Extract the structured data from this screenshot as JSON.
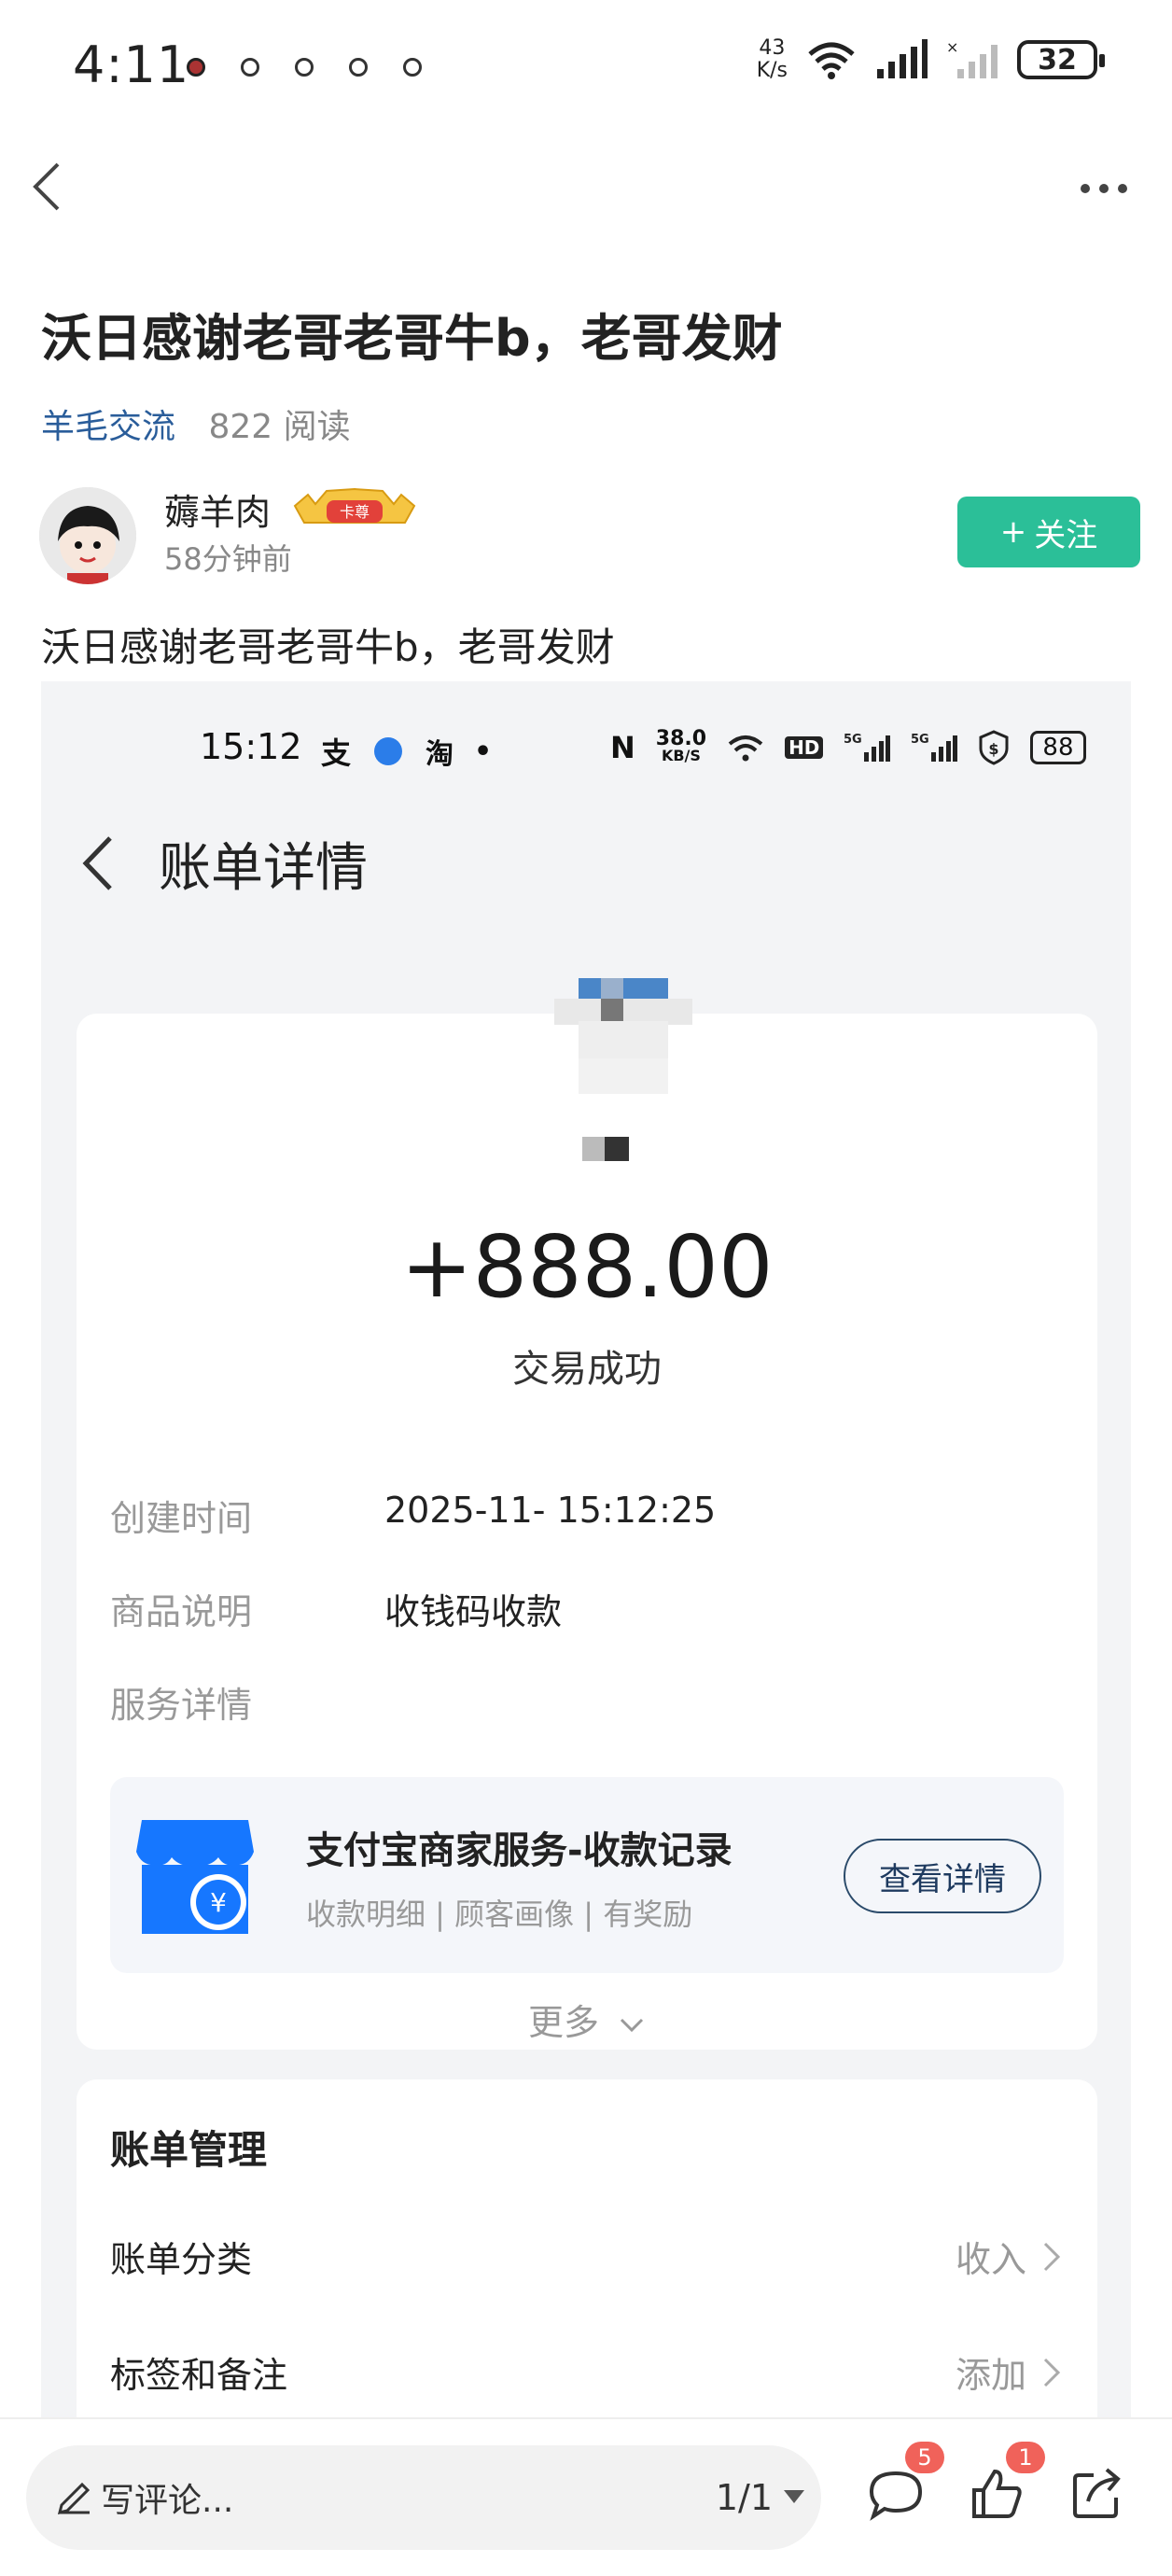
{
  "status_bar": {
    "time": "4:11",
    "net_speed_value": "43",
    "net_speed_unit": "K/s",
    "battery": "32"
  },
  "post": {
    "title": "沃日感谢老哥老哥牛b，老哥发财",
    "category": "羊毛交流",
    "reads": "822 阅读",
    "body": "沃日感谢老哥老哥牛b，老哥发财"
  },
  "author": {
    "name": "薅羊肉",
    "badge": "卡尊",
    "time": "58分钟前",
    "follow_label": "关注"
  },
  "screenshot": {
    "status_time": "15:12",
    "net_speed_value": "38.0",
    "net_speed_unit": "KB/S",
    "battery": "88",
    "page_title": "账单详情",
    "amount": "+888.00",
    "trade_status": "交易成功",
    "rows": [
      {
        "label": "创建时间",
        "value": "2025-11-  15:12:25"
      },
      {
        "label": "商品说明",
        "value": "收钱码收款"
      },
      {
        "label": "服务详情",
        "value": ""
      }
    ],
    "service": {
      "title": "支付宝商家服务-收款记录",
      "subtitle": "收款明细 | 顾客画像 | 有奖励",
      "button": "查看详情"
    },
    "more": "更多",
    "management": {
      "title": "账单管理",
      "items": [
        {
          "label": "账单分类",
          "value": "收入"
        },
        {
          "label": "标签和备注",
          "value": "添加"
        }
      ]
    }
  },
  "bottom_bar": {
    "comment_placeholder": "写评论...",
    "page_indicator": "1/1",
    "comment_count": "5",
    "like_count": "1"
  },
  "colors": {
    "follow_green": "#2bbf98",
    "category_blue": "#2a5d9a",
    "badge_red": "#f0625a"
  }
}
